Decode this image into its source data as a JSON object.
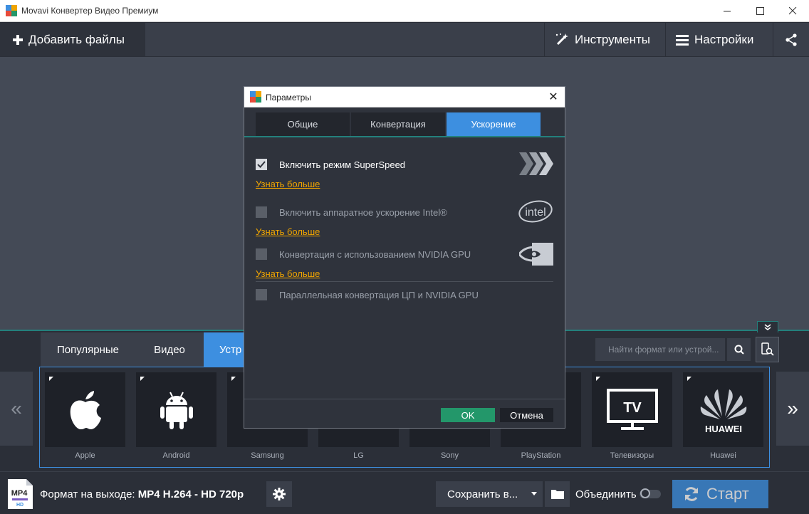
{
  "window": {
    "title": "Movavi Конвертер Видео Премиум",
    "minimize": "—",
    "maximize": "☐",
    "close": "✕"
  },
  "toolbar": {
    "add_files": "Добавить файлы",
    "tools": "Инструменты",
    "settings": "Настройки"
  },
  "formats": {
    "tabs": [
      {
        "label": "Популярные",
        "active": false
      },
      {
        "label": "Видео",
        "active": false
      },
      {
        "label": "Устр",
        "active": true
      }
    ],
    "search_placeholder": "Найти формат или устрой...",
    "devices": [
      {
        "label": "Apple",
        "icon": "apple-icon"
      },
      {
        "label": "Android",
        "icon": "android-icon"
      },
      {
        "label": "Samsung",
        "icon": "samsung-icon"
      },
      {
        "label": "LG",
        "icon": "lg-icon"
      },
      {
        "label": "Sony",
        "icon": "sony-icon"
      },
      {
        "label": "PlayStation",
        "icon": "playstation-icon"
      },
      {
        "label": "Телевизоры",
        "icon": "tv-icon",
        "icon_text": "TV"
      },
      {
        "label": "Huawei",
        "icon": "huawei-icon",
        "icon_text": "HUAWEI"
      }
    ],
    "prev_arrow": "«",
    "next_arrow": "»"
  },
  "status": {
    "format_prefix": "Формат на выходе:",
    "format_value": "MP4 H.264 - HD 720p",
    "mp4_badge": "MP4",
    "hd_badge": "HD",
    "save_to": "Сохранить в...",
    "merge": "Объединить",
    "merge_on": false,
    "start": "Старт"
  },
  "dialog": {
    "title": "Параметры",
    "close": "✕",
    "tabs": [
      {
        "label": "Общие",
        "active": false
      },
      {
        "label": "Конвертация",
        "active": false
      },
      {
        "label": "Ускорение",
        "active": true
      }
    ],
    "options": [
      {
        "label": "Включить режим SuperSpeed",
        "checked": true,
        "enabled": true,
        "more": "Узнать больше"
      },
      {
        "label": "Включить аппаратное ускорение Intel®",
        "checked": false,
        "enabled": false,
        "more": "Узнать больше",
        "logo_text": "intel"
      },
      {
        "label": "Конвертация с использованием NVIDIA GPU",
        "checked": false,
        "enabled": false,
        "more": "Узнать больше"
      },
      {
        "label": "Параллельная конвертация ЦП и NVIDIA GPU",
        "checked": false,
        "enabled": false
      }
    ],
    "ok": "OK",
    "cancel": "Отмена"
  },
  "colors": {
    "accent_blue": "#3d8fe0",
    "teal": "#23807c",
    "ok_green": "#23976a",
    "link_orange": "#f0a500"
  }
}
